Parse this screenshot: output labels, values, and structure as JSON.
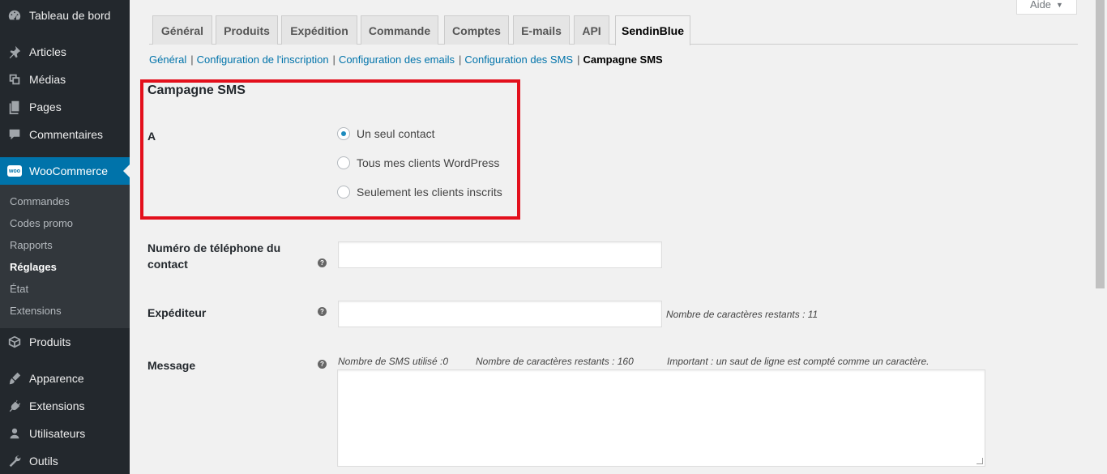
{
  "sidebar": {
    "items": [
      {
        "label": "Tableau de bord",
        "icon": "dashboard-icon"
      },
      {
        "label": "Articles",
        "icon": "pin-icon"
      },
      {
        "label": "Médias",
        "icon": "media-icon"
      },
      {
        "label": "Pages",
        "icon": "pages-icon"
      },
      {
        "label": "Commentaires",
        "icon": "comment-icon"
      },
      {
        "label": "WooCommerce",
        "icon": "woo-icon",
        "badge": "woo"
      },
      {
        "label": "Produits",
        "icon": "box-icon"
      },
      {
        "label": "Apparence",
        "icon": "brush-icon"
      },
      {
        "label": "Extensions",
        "icon": "plugin-icon"
      },
      {
        "label": "Utilisateurs",
        "icon": "user-icon"
      },
      {
        "label": "Outils",
        "icon": "wrench-icon"
      }
    ],
    "submenu": [
      "Commandes",
      "Codes promo",
      "Rapports",
      "Réglages",
      "État",
      "Extensions"
    ],
    "accent_color": "#0073aa"
  },
  "help": {
    "label": "Aide",
    "arrow": "▼"
  },
  "tabs": [
    "Général",
    "Produits",
    "Expédition",
    "Commande",
    "Comptes",
    "E-mails",
    "API",
    "SendinBlue"
  ],
  "subnav": {
    "links": [
      "Général",
      "Configuration de l'inscription",
      "Configuration des emails",
      "Configuration des SMS"
    ],
    "current": "Campagne SMS",
    "separator": "|"
  },
  "form": {
    "section_title": "Campagne SMS",
    "to_label": "A",
    "recipients": [
      "Un seul contact",
      "Tous mes clients WordPress",
      "Seulement les clients inscrits"
    ],
    "selected_recipient": "Un seul contact",
    "phone_label_line1": "Numéro de téléphone du",
    "phone_label_line2": "contact",
    "phone_value": "",
    "sender_label": "Expéditeur",
    "sender_value": "",
    "sender_remaining": "Nombre de caractères restants :  11",
    "message_label": "Message",
    "sms_used": "Nombre de SMS utilisé :0",
    "message_remaining": "Nombre de caractères restants : 160",
    "message_note": "Important : un saut de ligne est compté comme un caractère.",
    "message_value": "",
    "help_tip": "?"
  },
  "highlight_color": "#e3101c"
}
